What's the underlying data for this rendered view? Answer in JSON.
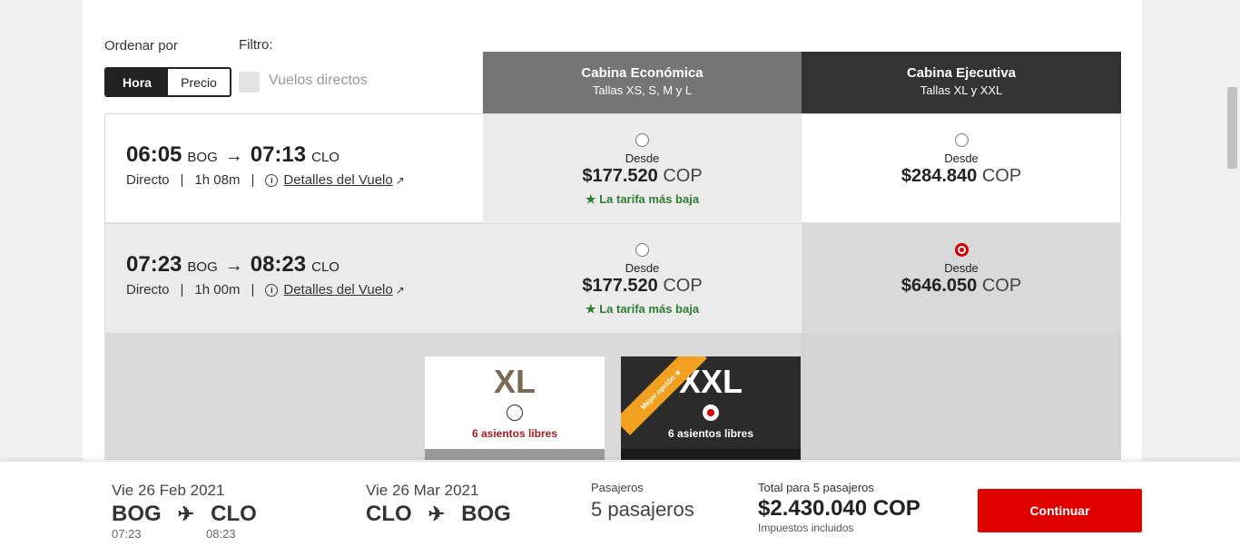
{
  "controls": {
    "sort_label": "Ordenar por",
    "filter_label": "Filtro:",
    "sort_options": [
      "Hora",
      "Precio"
    ],
    "direct_flights_label": "Vuelos directos"
  },
  "cabins": [
    {
      "name": "Cabina Económica",
      "sizes": "Tallas XS, S, M y L"
    },
    {
      "name": "Cabina Ejecutiva",
      "sizes": "Tallas XL y XXL"
    }
  ],
  "flights": [
    {
      "depart_time": "06:05",
      "depart_airport": "BOG",
      "arrive_time": "07:13",
      "arrive_airport": "CLO",
      "type": "Directo",
      "duration": "1h 08m",
      "details_label": "Detalles del Vuelo",
      "eco": {
        "from": "Desde",
        "price": "$177.520",
        "currency": "COP",
        "badge": "★ La tarifa más baja"
      },
      "exe": {
        "from": "Desde",
        "price": "$284.840",
        "currency": "COP"
      }
    },
    {
      "depart_time": "07:23",
      "depart_airport": "BOG",
      "arrive_time": "08:23",
      "arrive_airport": "CLO",
      "type": "Directo",
      "duration": "1h 00m",
      "details_label": "Detalles del Vuelo",
      "eco": {
        "from": "Desde",
        "price": "$177.520",
        "currency": "COP",
        "badge": "★ La tarifa más baja"
      },
      "exe": {
        "from": "Desde",
        "price": "$646.050",
        "currency": "COP"
      }
    }
  ],
  "seat_options": [
    {
      "size": "XL",
      "seats": "6 asientos libres"
    },
    {
      "size": "XXL",
      "seats": "6 asientos libres",
      "ribbon": "Mejor opción ★"
    }
  ],
  "summary": {
    "outbound": {
      "date": "Vie 26 Feb 2021",
      "from": "BOG",
      "to": "CLO",
      "depart_time": "07:23",
      "arrive_time": "08:23"
    },
    "return": {
      "date": "Vie 26 Mar 2021",
      "from": "CLO",
      "to": "BOG"
    },
    "passengers_label": "Pasajeros",
    "passengers_value": "5 pasajeros",
    "total_label": "Total para 5 pasajeros",
    "total_value": "$2.430.040 COP",
    "tax_note": "Impuestos incluidos",
    "continue_label": "Continuar"
  },
  "colors": {
    "accent": "#e00000",
    "badge_green": "#2e7d32",
    "ribbon": "#f2a01f"
  }
}
